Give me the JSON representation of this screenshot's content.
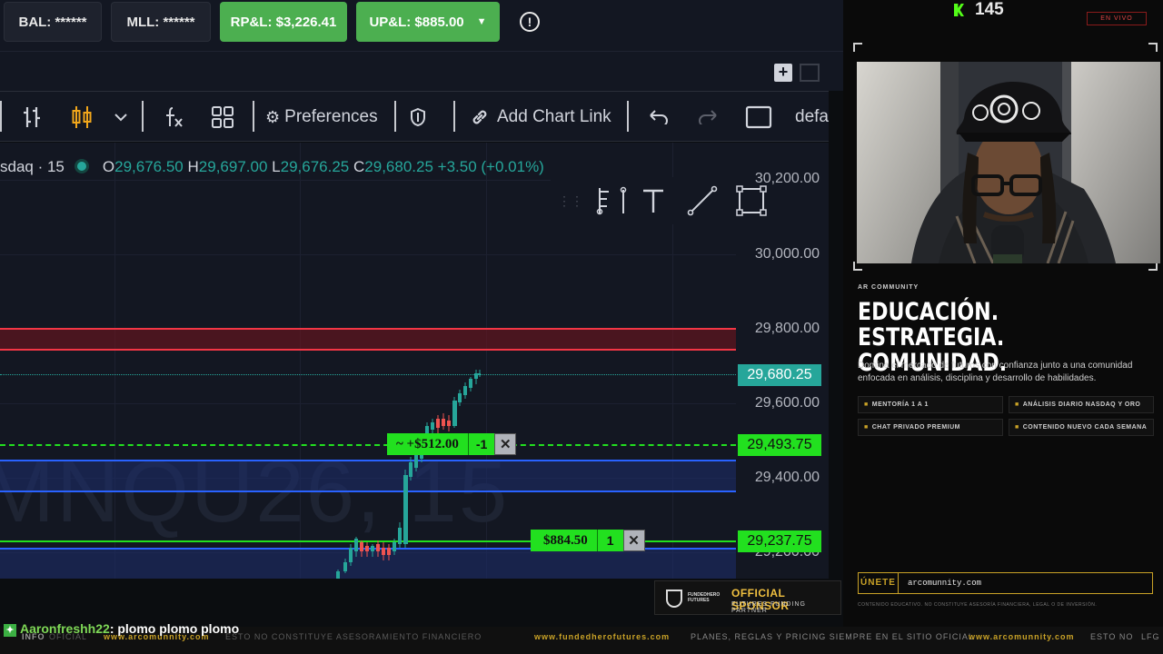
{
  "account_bar": {
    "bal": "BAL: ******",
    "mll": "MLL: ******",
    "rpl": "RP&L: $3,226.41",
    "upl": "UP&L: $885.00"
  },
  "toolbar": {
    "preferences": "Preferences",
    "add_chart_link": "Add Chart Link",
    "layout_name": "defa"
  },
  "chart": {
    "symbol_title": "sdaq · 15",
    "ohlc": {
      "o_label": "O",
      "o": "29,676.50",
      "h_label": "H",
      "h": "29,697.00",
      "l_label": "L",
      "l": "29,676.25",
      "c_label": "C",
      "c": "29,680.25",
      "change": "+3.50 (+0.01%)"
    },
    "watermark": "MNQU26, 15",
    "axis_labels": [
      "30,200.00",
      "30,000.00",
      "29,800.00",
      "29,600.00",
      "29,400.00",
      "29,200.00"
    ],
    "tags": {
      "last_price": "29,680.25",
      "entry_price": "29,493.75",
      "position_price": "29,237.75"
    },
    "orders": {
      "order1_pnl": "~ +$512.00",
      "order1_qty": "-1",
      "order2_pnl": "$884.50",
      "order2_qty": "1"
    },
    "colors": {
      "up": "#26a69a",
      "down": "#ef5350",
      "resistance": "#f23645",
      "support": "#2962ff",
      "order_green": "#22e01f"
    }
  },
  "stream": {
    "viewer_count": "145",
    "live_label": "EN VIVO",
    "brand_kicker": "AR COMMUNITY",
    "headline_line1": "EDUCACIÓN. ESTRATEGIA.",
    "headline_line2": "COMUNIDAD.",
    "description": "Domina el mercado de futuros con confianza junto a una comunidad enfocada en análisis, disciplina y desarrollo de habilidades.",
    "tags": [
      "MENTORÍA 1 A 1",
      "ANÁLISIS DIARIO NASDAQ Y ORO",
      "CHAT PRIVADO PREMIUM",
      "CONTENIDO NUEVO CADA SEMANA"
    ],
    "join_label": "ÚNETE",
    "join_url": "arcomunnity.com",
    "disclaimer": "CONTENIDO EDUCATIVO. NO CONSTITUYE ASESORÍA FINANCIERA, LEGAL O DE INVERSIÓN."
  },
  "sponsor": {
    "logo_text": "FUNDEDHERO FUTURES",
    "title": "OFFICIAL SPONSOR",
    "subtitle": "FUTURES FUNDING PARTNER"
  },
  "chat": {
    "username": "Aaronfreshh22",
    "message": ": plomo plomo plomo"
  },
  "ticker": {
    "left_badge": "INFO",
    "segments": [
      "OFICIAL",
      "www.arcomunnity.com",
      "ESTO NO CONSTITUYE ASESORAMIENTO FINANCIERO",
      "www.fundedherofutures.com",
      "PLANES, REGLAS Y PRICING SIEMPRE EN EL SITIO OFICIAL",
      "www.arcomunnity.com",
      "ESTO NO",
      "LFG"
    ]
  }
}
